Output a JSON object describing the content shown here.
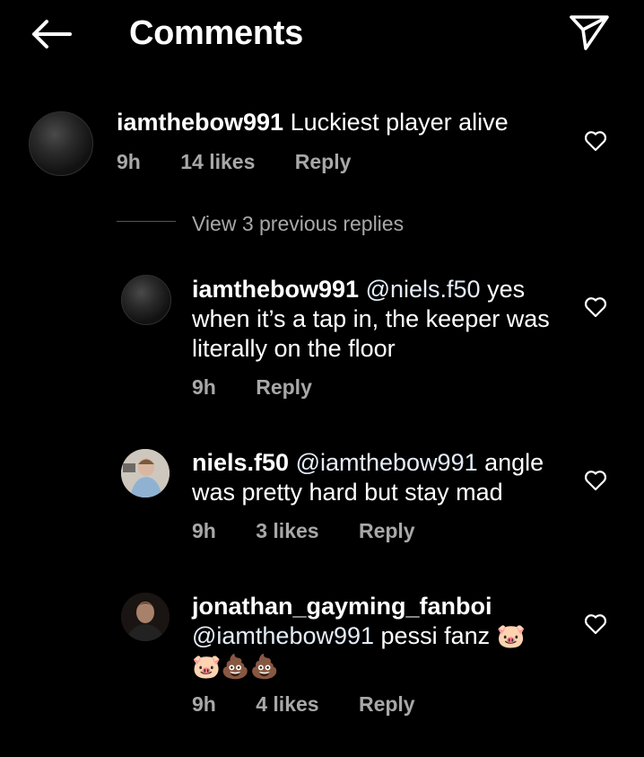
{
  "header": {
    "title": "Comments"
  },
  "comments": [
    {
      "username": "iamthebow991",
      "text": "Luckiest player alive",
      "time": "9h",
      "likes": "14 likes",
      "reply": "Reply"
    }
  ],
  "view_replies": "View 3 previous replies",
  "replies": [
    {
      "username": "iamthebow991",
      "mention": "@niels.f50",
      "text_line1": " yes",
      "text_line2": "when it’s a tap in, the keeper was",
      "text_line3": "literally on the floor",
      "time": "9h",
      "reply": "Reply"
    },
    {
      "username": "niels.f50",
      "mention": "@iamthebow991",
      "text_line1": " angle",
      "text_line2": "was pretty hard but stay mad",
      "time": "9h",
      "likes": "3 likes",
      "reply": "Reply"
    },
    {
      "username": "jonathan_gayming_fanboi",
      "mention": "@iamthebow991",
      "text_line1": " pessi fanz ",
      "emoji_line1": "🐷",
      "emoji_line2": "🐷💩💩",
      "time": "9h",
      "likes": "4 likes",
      "reply": "Reply"
    }
  ],
  "icons": {
    "back": "back-arrow-icon",
    "send": "send-icon",
    "heart": "heart-outline-icon"
  },
  "colors": {
    "background": "#000000",
    "text": "#ffffff",
    "secondary": "#a8a8a8"
  }
}
